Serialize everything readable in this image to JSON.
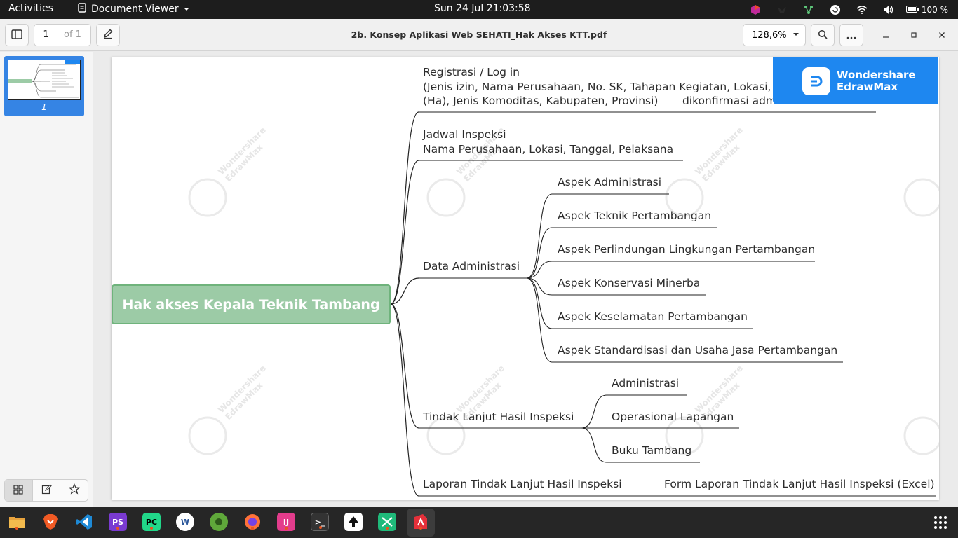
{
  "topbar": {
    "activities": "Activities",
    "app_name": "Document Viewer",
    "clock": "Sun 24 Jul  21:03:58",
    "battery": "100 %"
  },
  "header": {
    "page_current": "1",
    "page_of": "of 1",
    "title": "2b. Konsep Aplikasi Web SEHATI_Hak Akses KTT.pdf",
    "zoom": "128,6%"
  },
  "sidebar": {
    "thumbnail_label": "1"
  },
  "badge": {
    "line1": "Wondershare",
    "line2": "EdrawMax"
  },
  "watermark": {
    "line1": "Wondershare",
    "line2": "EdrawMax"
  },
  "mindmap": {
    "root": "Hak akses Kepala Teknik Tambang",
    "branches": {
      "registrasi": {
        "line1": "Registrasi / Log in",
        "line2": "(Jenis izin, Nama Perusahaan, No. SK, Tahapan Kegiatan, Lokasi, Luas",
        "line3": "(Ha), Jenis Komoditas, Kabupaten, Provinsi)       dikonfirmasi admin"
      },
      "jadwal": {
        "line1": "Jadwal Inspeksi",
        "line2": "Nama Perusahaan, Lokasi, Tanggal, Pelaksana"
      },
      "data_admin": {
        "label": "Data Administrasi",
        "children": [
          "Aspek Administrasi",
          "Aspek Teknik Pertambangan",
          "Aspek Perlindungan Lingkungan Pertambangan",
          "Aspek Konservasi Minerba",
          "Aspek Keselamatan Pertambangan",
          "Aspek Standardisasi dan Usaha Jasa Pertambangan"
        ]
      },
      "tindak_lanjut": {
        "label": "Tindak Lanjut Hasil Inspeksi",
        "children": [
          "Administrasi",
          "Operasional Lapangan",
          "Buku Tambang"
        ]
      },
      "laporan": {
        "label": "Laporan Tindak Lanjut Hasil Inspeksi",
        "child": "Form Laporan Tindak Lanjut Hasil Inspeksi (Excel)"
      }
    }
  },
  "dock": {
    "apps": [
      "files",
      "brave",
      "vscode",
      "phpstorm",
      "pycharm",
      "word",
      "apple-music",
      "firefox",
      "intellij",
      "terminal",
      "inkscape",
      "edrawmax-alt",
      "document-viewer"
    ]
  },
  "colors": {
    "root_fill": "#9ccba6",
    "root_border": "#6fb37c",
    "badge": "#1e87f0",
    "thumb_selected": "#3584e4"
  }
}
